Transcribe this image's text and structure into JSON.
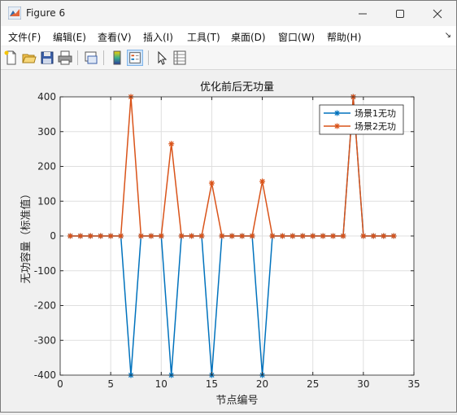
{
  "window": {
    "title": "Figure 6"
  },
  "menu": [
    "文件(F)",
    "编辑(E)",
    "查看(V)",
    "插入(I)",
    "工具(T)",
    "桌面(D)",
    "窗口(W)",
    "帮助(H)"
  ],
  "toolbar_icons": [
    "new-figure-icon",
    "open-file-icon",
    "save-icon",
    "print-icon",
    "link-plot-icon",
    "colorbar-icon",
    "legend-icon",
    "pointer-icon",
    "property-inspector-icon"
  ],
  "colors": {
    "series1": "#0072BD",
    "series2": "#D95319"
  },
  "chart_data": {
    "type": "line",
    "title": "优化前后无功量",
    "xlabel": "节点编号",
    "ylabel": "无功容量（标准值）",
    "xlim": [
      0,
      35
    ],
    "ylim": [
      -400,
      400
    ],
    "xticks": [
      0,
      5,
      10,
      15,
      20,
      25,
      30,
      35
    ],
    "yticks": [
      -400,
      -300,
      -200,
      -100,
      0,
      100,
      200,
      300,
      400
    ],
    "grid": true,
    "legend_position": "top-right",
    "x": [
      1,
      2,
      3,
      4,
      5,
      6,
      7,
      8,
      9,
      10,
      11,
      12,
      13,
      14,
      15,
      16,
      17,
      18,
      19,
      20,
      21,
      22,
      23,
      24,
      25,
      26,
      27,
      28,
      29,
      30,
      31,
      32,
      33
    ],
    "series": [
      {
        "name": "场景1无功",
        "values": [
          0,
          0,
          0,
          0,
          0,
          0,
          -400,
          0,
          0,
          0,
          -400,
          0,
          0,
          0,
          -400,
          0,
          0,
          0,
          0,
          -400,
          0,
          0,
          0,
          0,
          0,
          0,
          0,
          0,
          400,
          0,
          0,
          0,
          0
        ]
      },
      {
        "name": "场景2无功",
        "values": [
          0,
          0,
          0,
          0,
          0,
          0,
          400,
          0,
          0,
          0,
          265,
          0,
          0,
          0,
          152,
          0,
          0,
          0,
          0,
          157,
          0,
          0,
          0,
          0,
          0,
          0,
          0,
          0,
          400,
          0,
          0,
          0,
          0
        ]
      }
    ]
  }
}
